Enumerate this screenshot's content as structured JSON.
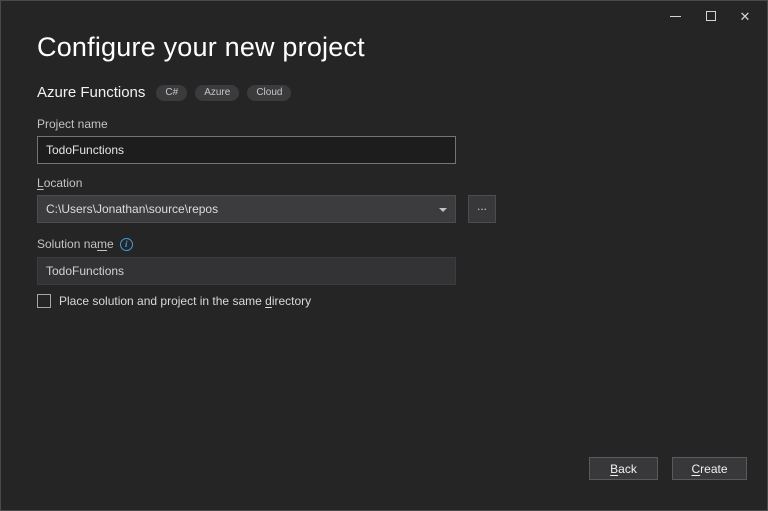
{
  "window": {
    "title": "Configure your new project",
    "controls": {
      "minimize": "minimize-icon",
      "maximize": "maximize-icon",
      "close_glyph": "✕"
    }
  },
  "template_info": {
    "name": "Azure Functions",
    "tags": [
      "C#",
      "Azure",
      "Cloud"
    ]
  },
  "form": {
    "project_name": {
      "label": "Project name",
      "value": "TodoFunctions"
    },
    "location": {
      "label_key": "L",
      "label_post": "ocation",
      "value": "C:\\Users\\Jonathan\\source\\repos",
      "browse_label": "..."
    },
    "solution_name": {
      "label_pre": "Solution na",
      "label_key": "m",
      "label_post": "e",
      "value": "TodoFunctions",
      "info_letter": "i"
    },
    "same_directory_checkbox": {
      "checked": false,
      "label_pre": "Place solution and project in the same ",
      "label_key": "d",
      "label_post": "irectory"
    }
  },
  "footer": {
    "back_key": "B",
    "back_post": "ack",
    "create_key": "C",
    "create_post": "reate"
  },
  "colors": {
    "background": "#252526",
    "field_focus_border": "#747476",
    "info_accent": "#3b9eda"
  }
}
